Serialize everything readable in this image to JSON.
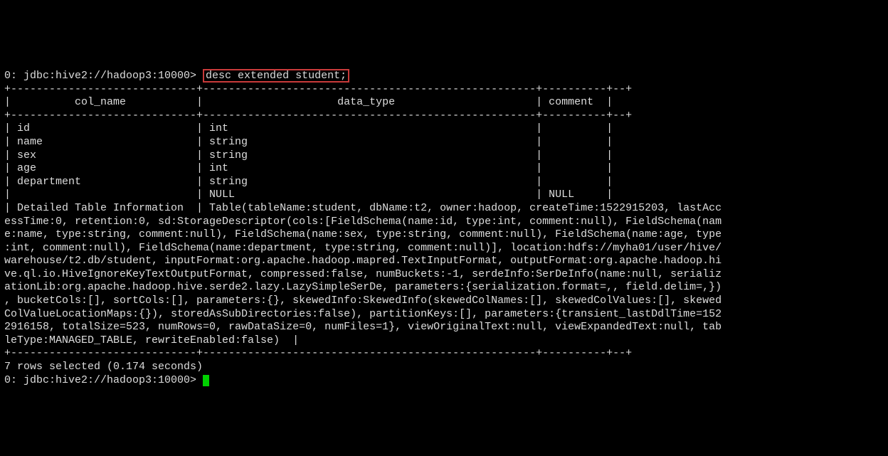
{
  "prompt": {
    "prefix": "0: jdbc:hive2://hadoop3:10000> ",
    "command": "desc extended student;"
  },
  "table": {
    "rule_top": "+-----------------------------+----------------------------------------------------+----------+--+",
    "rule_sep": "+-----------------------------+----------------------------------------------------+----------+--+",
    "rule_bottom": "+-----------------------------+----------------------------------------------------+----------+--+",
    "header_line": "|          col_name           |                     data_type                      | comment  |",
    "cols": [
      "col_name",
      "data_type",
      "comment"
    ],
    "rows": [
      {
        "col_name": "id",
        "data_type": "int",
        "comment": ""
      },
      {
        "col_name": "name",
        "data_type": "string",
        "comment": ""
      },
      {
        "col_name": "sex",
        "data_type": "string",
        "comment": ""
      },
      {
        "col_name": "age",
        "data_type": "int",
        "comment": ""
      },
      {
        "col_name": "department",
        "data_type": "string",
        "comment": ""
      },
      {
        "col_name": "",
        "data_type": "NULL",
        "comment": "NULL"
      }
    ],
    "row_lines": [
      "| id                          | int                                                |          |",
      "| name                        | string                                             |          |",
      "| sex                         | string                                             |          |",
      "| age                         | int                                                |          |",
      "| department                  | string                                             |          |",
      "|                             | NULL                                               | NULL     |"
    ],
    "detailed_lines": [
      "| Detailed Table Information  | Table(tableName:student, dbName:t2, owner:hadoop, createTime:1522915203, lastAcc",
      "essTime:0, retention:0, sd:StorageDescriptor(cols:[FieldSchema(name:id, type:int, comment:null), FieldSchema(nam",
      "e:name, type:string, comment:null), FieldSchema(name:sex, type:string, comment:null), FieldSchema(name:age, type",
      ":int, comment:null), FieldSchema(name:department, type:string, comment:null)], location:hdfs://myha01/user/hive/",
      "warehouse/t2.db/student, inputFormat:org.apache.hadoop.mapred.TextInputFormat, outputFormat:org.apache.hadoop.hi",
      "ve.ql.io.HiveIgnoreKeyTextOutputFormat, compressed:false, numBuckets:-1, serdeInfo:SerDeInfo(name:null, serializ",
      "ationLib:org.apache.hadoop.hive.serde2.lazy.LazySimpleSerDe, parameters:{serialization.format=,, field.delim=,})",
      ", bucketCols:[], sortCols:[], parameters:{}, skewedInfo:SkewedInfo(skewedColNames:[], skewedColValues:[], skewed",
      "ColValueLocationMaps:{}), storedAsSubDirectories:false), partitionKeys:[], parameters:{transient_lastDdlTime=152",
      "2916158, totalSize=523, numRows=0, rawDataSize=0, numFiles=1}, viewOriginalText:null, viewExpandedText:null, tab",
      "leType:MANAGED_TABLE, rewriteEnabled:false)  |"
    ]
  },
  "result_line": "7 rows selected (0.174 seconds)",
  "prompt2": "0: jdbc:hive2://hadoop3:10000> ",
  "chart_data": null
}
